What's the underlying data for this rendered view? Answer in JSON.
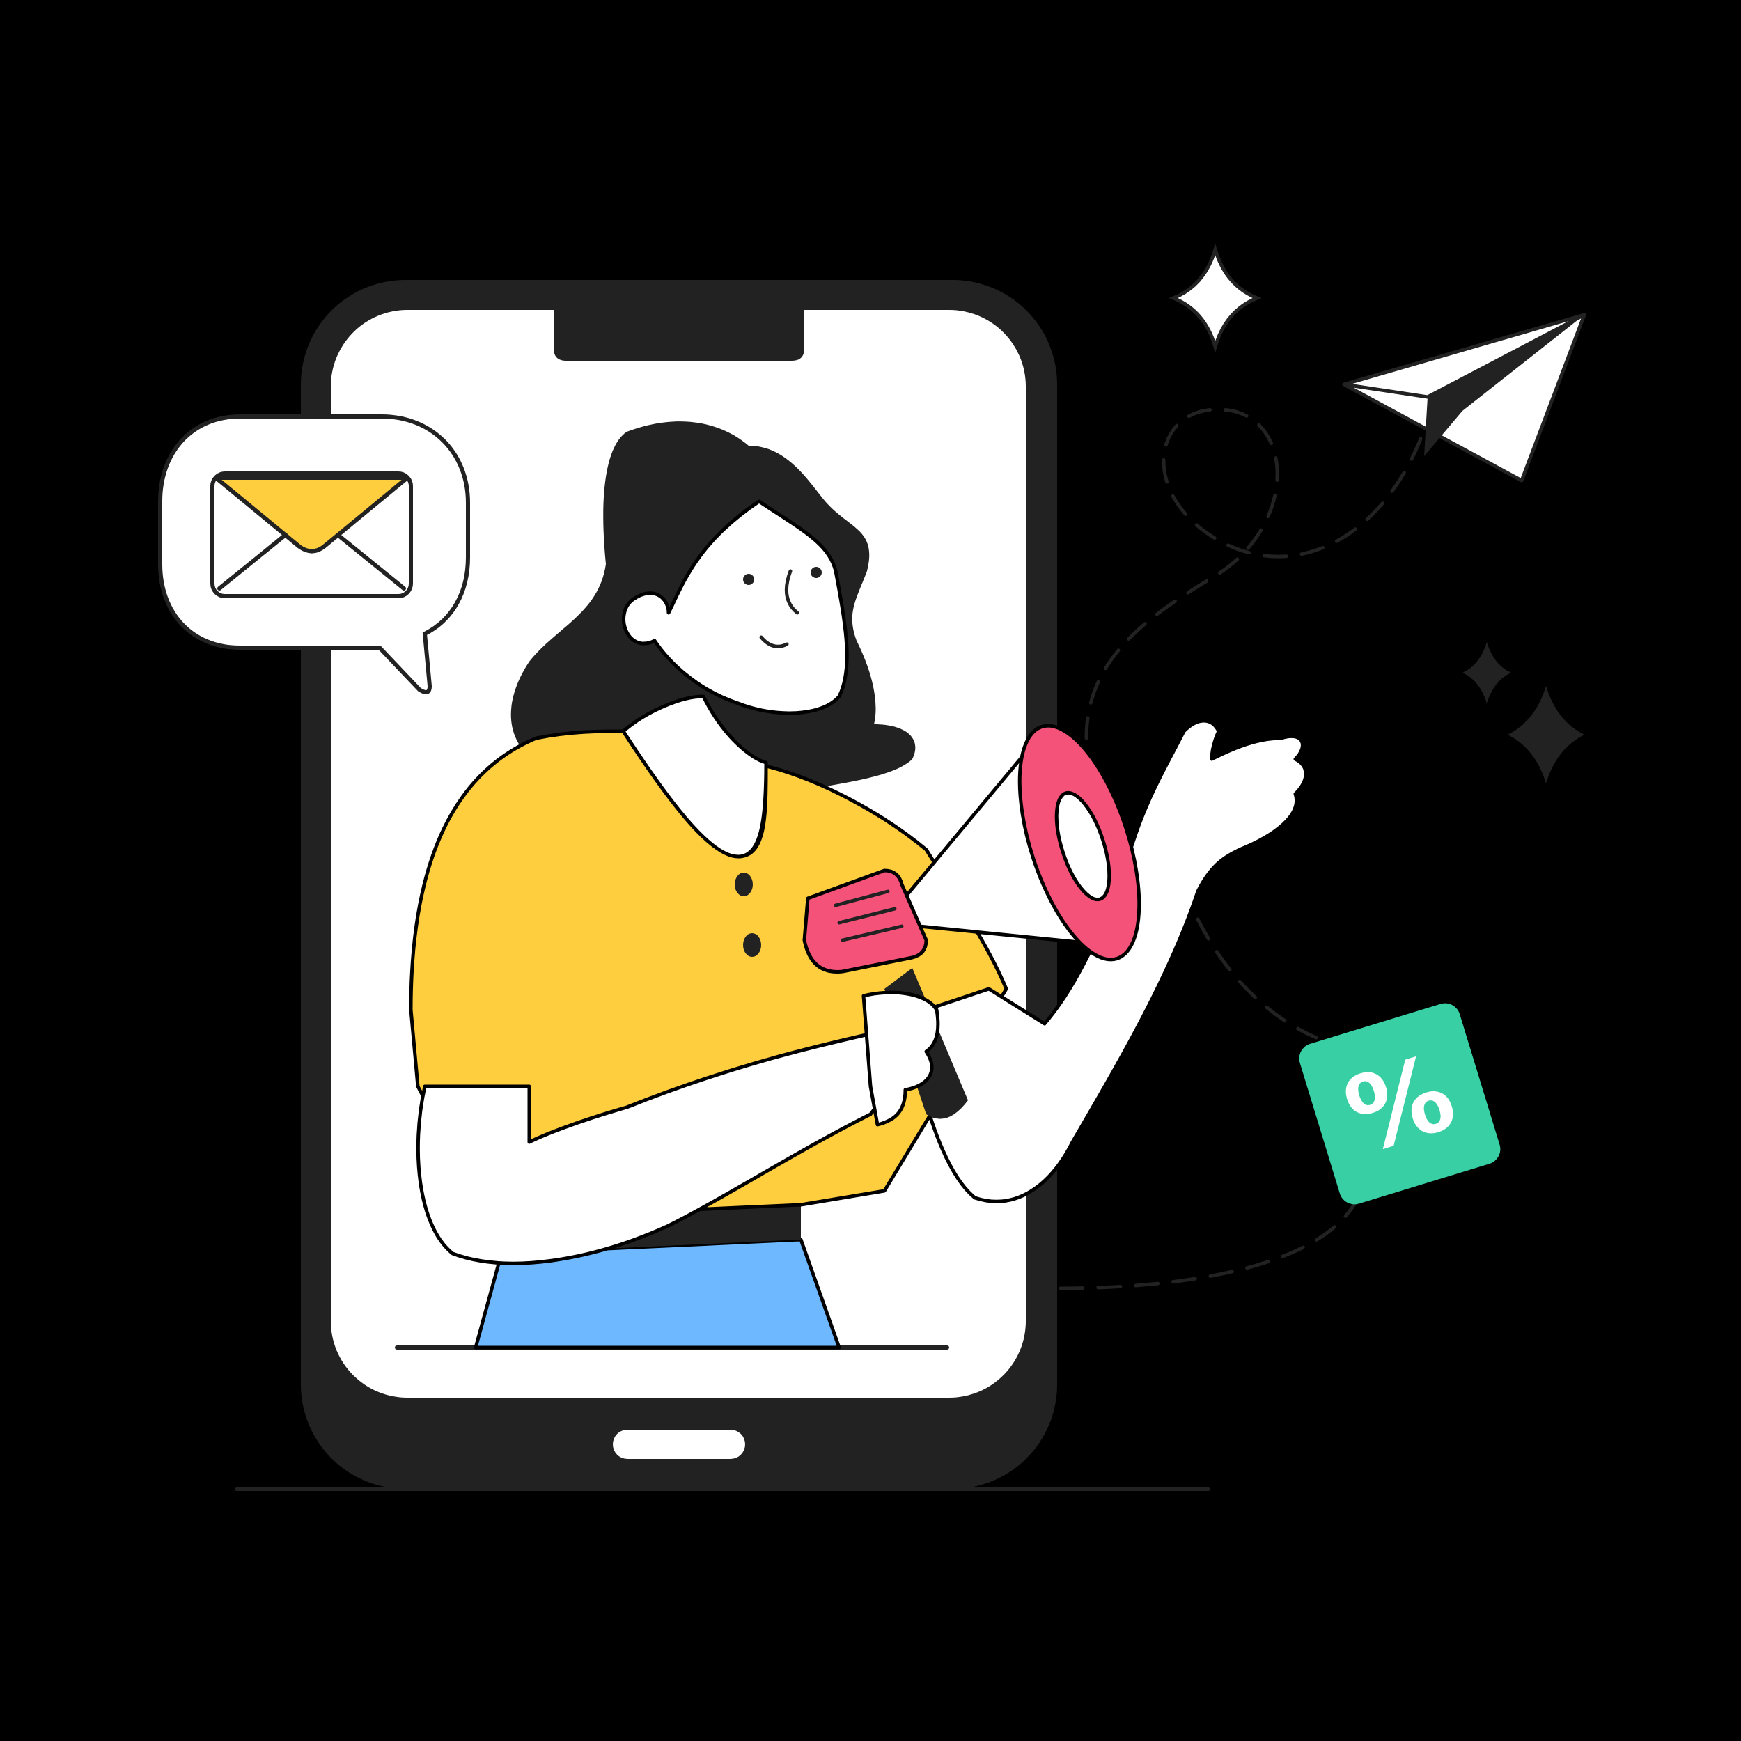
{
  "illustration": {
    "discount_badge": {
      "symbol": "%"
    },
    "icons": [
      "smartphone-icon",
      "envelope-icon",
      "chat-bubble-icon",
      "megaphone-icon",
      "paper-plane-icon",
      "sparkle-icon",
      "percent-badge-icon"
    ]
  },
  "colors": {
    "background": "#000000",
    "phone_body": "#222222",
    "screen": "#FFFFFF",
    "envelope": "#FFCE3F",
    "shirt": "#FFCE3F",
    "skirt": "#6EB8FF",
    "megaphone": "#F5527A",
    "badge": "#39CFA4",
    "hair": "#222222"
  }
}
